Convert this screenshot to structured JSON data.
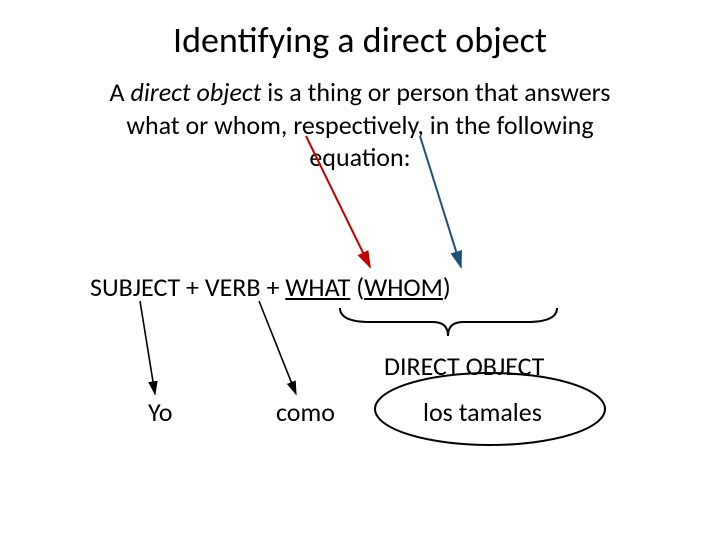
{
  "title": "Identifying a direct object",
  "definition": {
    "pre": "A ",
    "term": "direct object",
    "post": " is a thing or person that answers what or whom, respectively, in the following equation:"
  },
  "equation": {
    "subject": "SUBJECT",
    "plus1": " + ",
    "verb": "VERB",
    "plus2": " + ",
    "what": "WHAT",
    "space": " ",
    "lparen": "(",
    "whom": "WHOM",
    "rparen": ")"
  },
  "direct_object_label": "DIRECT OBJECT",
  "example": {
    "subject": "Yo",
    "verb": "como",
    "object": "los tamales"
  },
  "colors": {
    "red": "#C00000",
    "blue": "#1F4E79",
    "black": "#000000"
  }
}
